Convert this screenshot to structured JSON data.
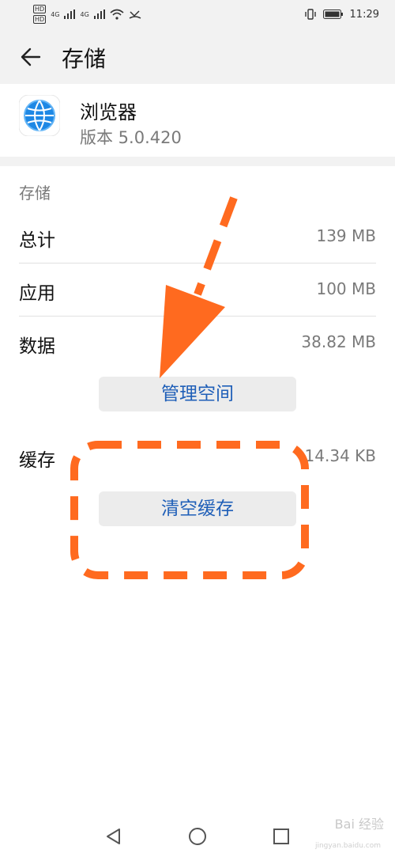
{
  "status_bar": {
    "hd1": "HD",
    "hd2": "HD",
    "net1": "4G",
    "net2": "4G",
    "time": "11:29"
  },
  "header": {
    "title": "存储"
  },
  "app": {
    "name": "浏览器",
    "version": "版本 5.0.420"
  },
  "storage": {
    "section_title": "存储",
    "rows": [
      {
        "label": "总计",
        "value": "139 MB"
      },
      {
        "label": "应用",
        "value": "100 MB"
      },
      {
        "label": "数据",
        "value": "38.82 MB"
      }
    ],
    "manage_button": "管理空间",
    "cache_label": "缓存",
    "cache_value": "14.34 KB",
    "clear_cache_button": "清空缓存"
  },
  "watermark": {
    "text": "Bai 经验",
    "sub": "jingyan.baidu.com"
  },
  "colors": {
    "accent": "#1f5fb8",
    "annotation": "#ff6a1f"
  }
}
